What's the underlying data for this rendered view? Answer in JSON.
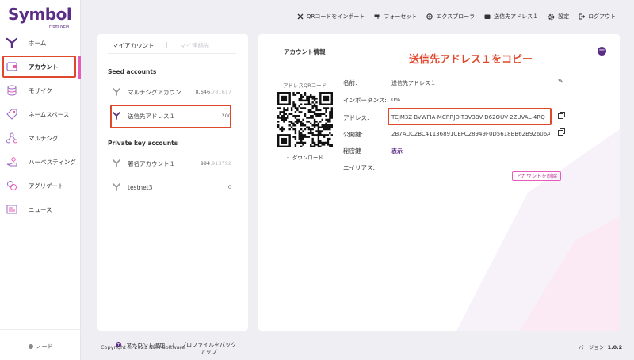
{
  "app": {
    "logo_text": "Symbol",
    "logo_sub": "From NEM",
    "brand_color": "#5a2e86",
    "accent_color": "#e85cb9",
    "annotation_color": "#e0482d"
  },
  "sidebar": {
    "items": [
      {
        "label": "ホーム",
        "icon": "symbol-home-icon"
      },
      {
        "label": "アカウント",
        "icon": "wallet-icon"
      },
      {
        "label": "モザイク",
        "icon": "mosaic-stack-icon"
      },
      {
        "label": "ネームスペース",
        "icon": "tag-icon"
      },
      {
        "label": "マルチシグ",
        "icon": "multisig-icon"
      },
      {
        "label": "ハーベスティング",
        "icon": "harvest-hand-icon"
      },
      {
        "label": "アグリゲート",
        "icon": "aggregate-icon"
      },
      {
        "label": "ニュース",
        "icon": "news-icon"
      }
    ],
    "active_index": 1,
    "node_label": "ノード"
  },
  "topbar": {
    "items": [
      {
        "label": "QRコードをインポート",
        "icon": "qr-import-icon"
      },
      {
        "label": "フォーセット",
        "icon": "faucet-icon"
      },
      {
        "label": "エクスプローラ",
        "icon": "explorer-icon"
      },
      {
        "label": "送信先アドレス１",
        "icon": "wallet-small-icon"
      },
      {
        "label": "設定",
        "icon": "gear-icon"
      },
      {
        "label": "ログアウト",
        "icon": "logout-icon"
      }
    ]
  },
  "accounts_panel": {
    "tabs": {
      "my_accounts": "マイアカウント",
      "separator": "|",
      "contacts": "マイ連絡先"
    },
    "seed_title": "Seed accounts",
    "seed_accounts": [
      {
        "name": "マルチシグアカウン...",
        "balance_int": "8,646",
        "balance_frac": ".781617"
      },
      {
        "name": "送信先アドレス１",
        "balance_int": "200",
        "balance_frac": ""
      }
    ],
    "private_title": "Private key accounts",
    "private_accounts": [
      {
        "name": "署名アカウント１",
        "balance_int": "994",
        "balance_frac": ".913792"
      },
      {
        "name": "testnet3",
        "balance_int": "0",
        "balance_frac": ""
      }
    ],
    "add_account": "アカウント追加",
    "backup_profile": "プロファイルをバックアップ"
  },
  "account_info": {
    "title": "アカウント情報",
    "annotation": "送信先アドレス１をコピー",
    "qr_label": "アドレスQRコード",
    "download_label": "ダウンロード",
    "rows": {
      "name_label": "名前:",
      "name_value": "送信先アドレス１",
      "importance_label": "インポータンス:",
      "importance_value": "0%",
      "address_label": "アドレス:",
      "address_value": "TCJM3Z-BVWFIA-MCRRJD-T3V3BV-D62OUV-2ZUVAL-4RQ",
      "public_key_label": "公開鍵:",
      "public_key_value": "2B7ADC2BC41136891CEFC28949F0D5618BB62B92606A0F...",
      "private_key_label": "秘密鍵",
      "private_key_value": "表示",
      "alias_label": "エイリアス:"
    },
    "delete_button": "アカウントを削除"
  },
  "footer": {
    "copyright": "Copyright © 2021 NEM Software",
    "version_label": "バージョン: ",
    "version_value": "1.0.2"
  }
}
